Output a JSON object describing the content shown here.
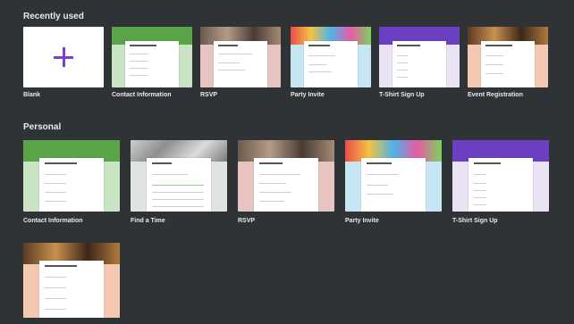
{
  "sections": {
    "recently_used": "Recently used",
    "personal": "Personal"
  },
  "recent": [
    {
      "label": "Blank"
    },
    {
      "label": "Contact Information"
    },
    {
      "label": "RSVP"
    },
    {
      "label": "Party Invite"
    },
    {
      "label": "T-Shirt Sign Up"
    },
    {
      "label": "Event Registration"
    }
  ],
  "personal": [
    {
      "label": "Contact Information"
    },
    {
      "label": "Find a Time"
    },
    {
      "label": "RSVP"
    },
    {
      "label": "Party Invite"
    },
    {
      "label": "T-Shirt Sign Up"
    }
  ],
  "icons": [
    "plus-icon"
  ],
  "colors": {
    "background": "#2f3336",
    "accent": "#7b3fd1"
  }
}
